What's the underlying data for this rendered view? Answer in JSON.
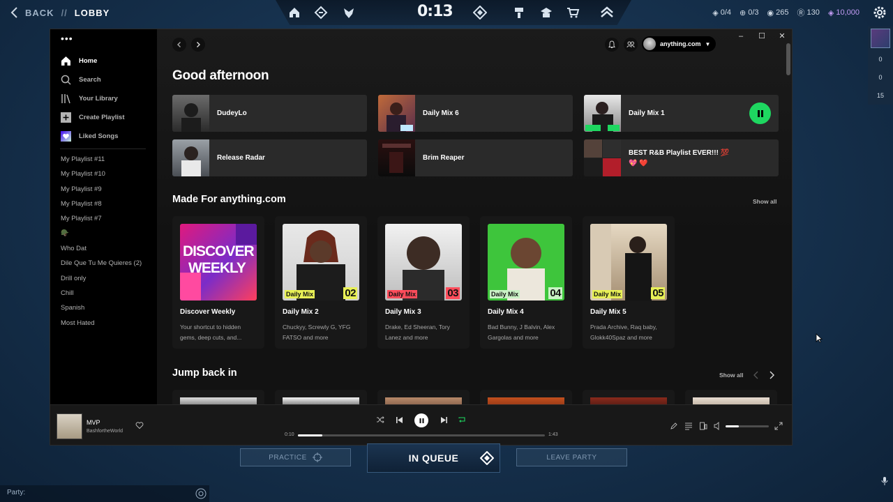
{
  "hud": {
    "back_label": "BACK",
    "slash": "//",
    "lobby_label": "LOBBY",
    "timer": "0:13",
    "stat_missions": "0/4",
    "stat_matches": "0/3",
    "vp": "265",
    "rp": "130",
    "radianite": "10,000",
    "side_counts": [
      "0",
      "0",
      "15"
    ]
  },
  "spotify": {
    "sidebar": {
      "nav": [
        {
          "label": "Home",
          "icon": "home-icon"
        },
        {
          "label": "Search",
          "icon": "search-icon"
        },
        {
          "label": "Your Library",
          "icon": "library-icon"
        },
        {
          "label": "Create Playlist",
          "icon": "plus-icon"
        },
        {
          "label": "Liked Songs",
          "icon": "heart-icon"
        }
      ],
      "playlists": [
        "My Playlist #11",
        "My Playlist #10",
        "My Playlist #9",
        "My Playlist #8",
        "My Playlist #7",
        "🪖",
        "Who Dat",
        "Dile Que Tu Me Quieres (2)",
        "Drill only",
        "Chill",
        "Spanish",
        "Most Hated"
      ]
    },
    "user": "anything.com",
    "greeting": "Good afternoon",
    "quick": [
      "DudeyLo",
      "Daily Mix 6",
      "Daily Mix 1",
      "Release Radar",
      "Brim Reaper",
      "BEST R&B Playlist EVER!!! 💯 💖 ❤️"
    ],
    "made_for_title": "Made For anything.com",
    "show_all": "Show all",
    "cards": [
      {
        "title": "Discover Weekly",
        "sub": "Your shortcut to hidden gems, deep cuts, and...",
        "art_text_1": "DISCOVER",
        "art_text_2": "WEEKLY"
      },
      {
        "title": "Daily Mix 2",
        "sub": "Chuckyy, Screwly G, YFG FATSO and more",
        "mix_label": "Daily Mix",
        "mix_num": "02"
      },
      {
        "title": "Daily Mix 3",
        "sub": "Drake, Ed Sheeran, Tory Lanez and more",
        "mix_label": "Daily Mix",
        "mix_num": "03"
      },
      {
        "title": "Daily Mix 4",
        "sub": "Bad Bunny, J Balvin, Alex Gargolas and more",
        "mix_label": "Daily Mix",
        "mix_num": "04"
      },
      {
        "title": "Daily Mix 5",
        "sub": "Prada Archive, Raq baby, Glokk40Spaz and more",
        "mix_label": "Daily Mix",
        "mix_num": "05"
      }
    ],
    "jump_title": "Jump back in",
    "player": {
      "title": "MVP",
      "artist": "BashfortheWorld",
      "current": "0:10",
      "total": "1:43",
      "progress": 0.1,
      "volume": 0.3
    }
  },
  "game_bottom": {
    "practice": "PRACTICE",
    "in_queue": "IN QUEUE",
    "leave_party": "LEAVE PARTY",
    "party_label": "Party:"
  }
}
